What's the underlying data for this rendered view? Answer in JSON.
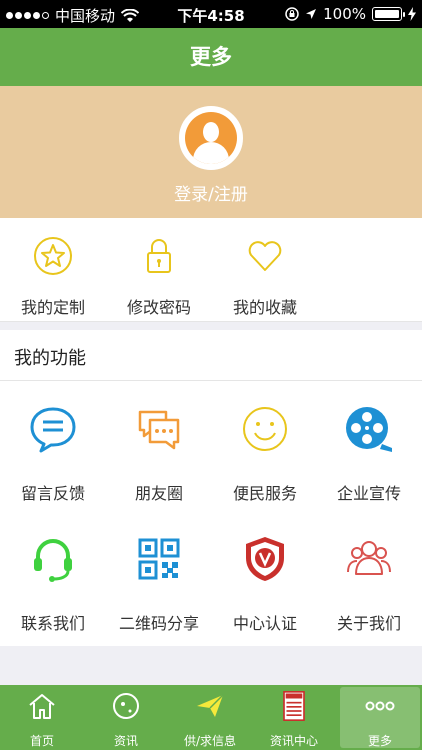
{
  "status_bar": {
    "carrier": "中国移动",
    "time": "下午4:58",
    "battery": "100%"
  },
  "nav": {
    "title": "更多"
  },
  "profile": {
    "login_label": "登录/注册"
  },
  "quick_actions": [
    {
      "label": "我的定制",
      "icon": "star-icon"
    },
    {
      "label": "修改密码",
      "icon": "lock-icon"
    },
    {
      "label": "我的收藏",
      "icon": "heart-icon"
    }
  ],
  "functions": {
    "title": "我的功能",
    "items": [
      {
        "label": "留言反馈",
        "icon": "chat-bubble-icon"
      },
      {
        "label": "朋友圈",
        "icon": "friends-chat-icon"
      },
      {
        "label": "便民服务",
        "icon": "smile-icon"
      },
      {
        "label": "企业宣传",
        "icon": "film-reel-icon"
      },
      {
        "label": "联系我们",
        "icon": "headset-icon"
      },
      {
        "label": "二维码分享",
        "icon": "qr-code-icon"
      },
      {
        "label": "中心认证",
        "icon": "verified-badge-icon"
      },
      {
        "label": "关于我们",
        "icon": "people-icon"
      }
    ]
  },
  "tabbar": {
    "items": [
      {
        "label": "首页",
        "icon": "home-icon"
      },
      {
        "label": "资讯",
        "icon": "news-circle-icon"
      },
      {
        "label": "供/求信息",
        "icon": "paper-plane-icon"
      },
      {
        "label": "资讯中心",
        "icon": "newspaper-icon"
      },
      {
        "label": "更多",
        "icon": "more-dots-icon",
        "active": true
      }
    ]
  },
  "colors": {
    "green": "#65ad4b",
    "tan": "#e9cb9f",
    "yellow": "#e8c51c",
    "blue": "#1e90d4",
    "orange": "#f29b39",
    "red": "#c9302c",
    "lime": "#3fd13f"
  }
}
